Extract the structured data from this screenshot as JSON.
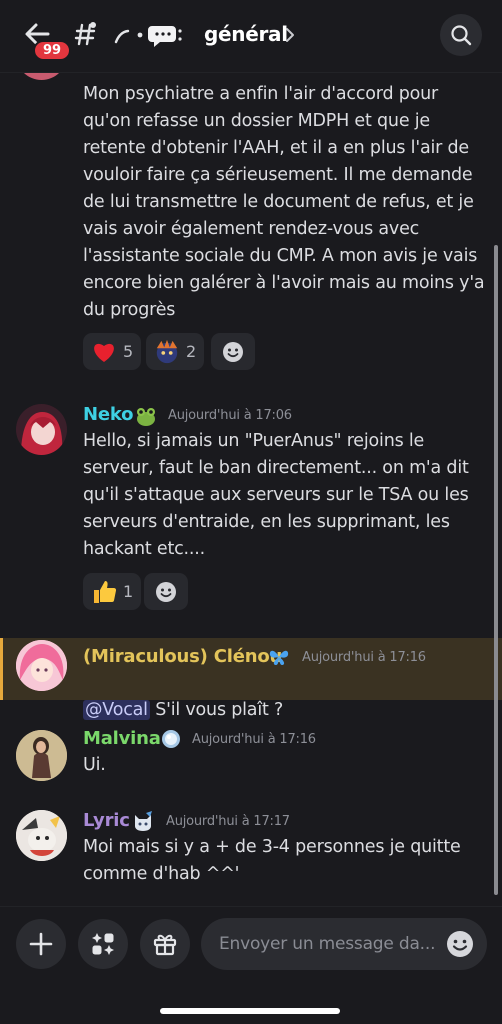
{
  "header": {
    "back_badge_count": "99",
    "channel_name": "général",
    "icons": {
      "back": "arrow-left-icon",
      "channel": "hash-icon",
      "search": "search-icon"
    }
  },
  "messages": [
    {
      "text": "Mon psychiatre a enfin l'air d'accord pour\nqu'on refasse un dossier MDPH et que je\nretente d'obtenir l'AAH, et il a en plus l'air de\nvouloir faire ça sérieusement. Il me demande\nde lui transmettre le document de refus, et je\nvais avoir également rendez-vous avec\nl'assistante sociale du CMP. A mon avis je vais\nencore bien galérer à l'avoir mais au moins y'a\ndu progrès",
      "reactions": [
        {
          "emoji": "heart",
          "count": "5"
        },
        {
          "emoji": "custom-avatar",
          "count": "2"
        }
      ]
    },
    {
      "author": "Neko",
      "author_color": "#3ed0e3",
      "timestamp": "Aujourd'hui à 17:06",
      "text": "Hello, si jamais un \"PuerAnus\" rejoins le\nserveur, faut le ban directement... on m'a dit\nqu'il s'attaque aux serveurs sur le TSA ou les\nserveurs d'entraide, en les supprimant, les\nhackant etc....",
      "reactions": [
        {
          "emoji": "thumbs-up",
          "count": "1"
        }
      ]
    },
    {
      "author": "(Miraculous) Clénou",
      "author_color": "#e3c45a",
      "timestamp": "Aujourd'hui à 17:16",
      "mention": "@Vocal",
      "text": " S'il vous plaît ?"
    },
    {
      "author": "Malvina",
      "author_color": "#7bd86b",
      "timestamp": "Aujourd'hui à 17:16",
      "text": "Ui."
    },
    {
      "author": "Lyric",
      "author_color": "#a98ad6",
      "timestamp": "Aujourd'hui à 17:17",
      "text": "Moi mais si y a + de 3-4 personnes je quitte\ncomme d'hab ^^'"
    }
  ],
  "composer": {
    "placeholder": "Envoyer un message da...",
    "icons": [
      "plus-icon",
      "apps-icon",
      "gift-icon",
      "emoji-icon"
    ]
  }
}
